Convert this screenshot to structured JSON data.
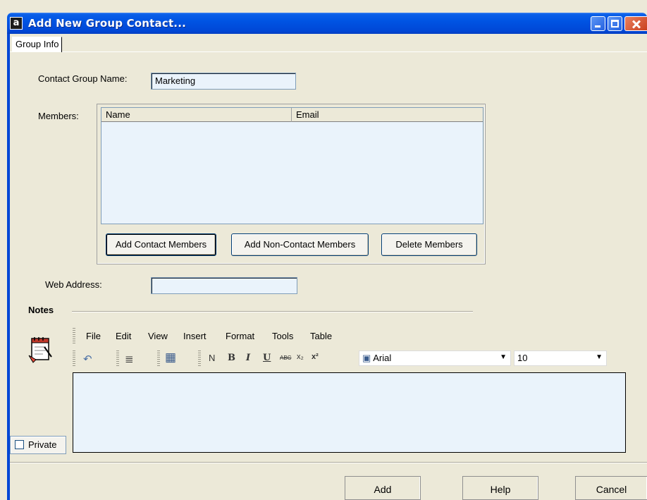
{
  "window": {
    "title": "Add New Group Contact...",
    "app_icon_letter": "a"
  },
  "tabs": [
    {
      "label": "Group Info"
    }
  ],
  "form": {
    "group_name_label": "Contact Group Name:",
    "group_name_value": "Marketing",
    "members_label": "Members:",
    "columns": [
      "Name",
      "Email"
    ],
    "members": [],
    "web_address_label": "Web Address:",
    "web_address_value": ""
  },
  "member_buttons": {
    "add_contact": "Add Contact Members",
    "add_non_contact": "Add Non-Contact Members",
    "delete": "Delete Members"
  },
  "notes": {
    "title": "Notes",
    "menu": [
      "File",
      "Edit",
      "View",
      "Insert",
      "Format",
      "Tools",
      "Table"
    ],
    "toolbar": {
      "undo": "↶",
      "align": "≣",
      "table": "▦",
      "normal": "N",
      "bold": "B",
      "italic": "I",
      "underline": "U",
      "strike": "ABC",
      "subscript": "x₂",
      "superscript": "x²",
      "font": "Arial",
      "size": "10"
    },
    "content": ""
  },
  "private": {
    "label": "Private",
    "checked": false
  },
  "footer": {
    "add": "Add",
    "help": "Help",
    "cancel": "Cancel"
  }
}
